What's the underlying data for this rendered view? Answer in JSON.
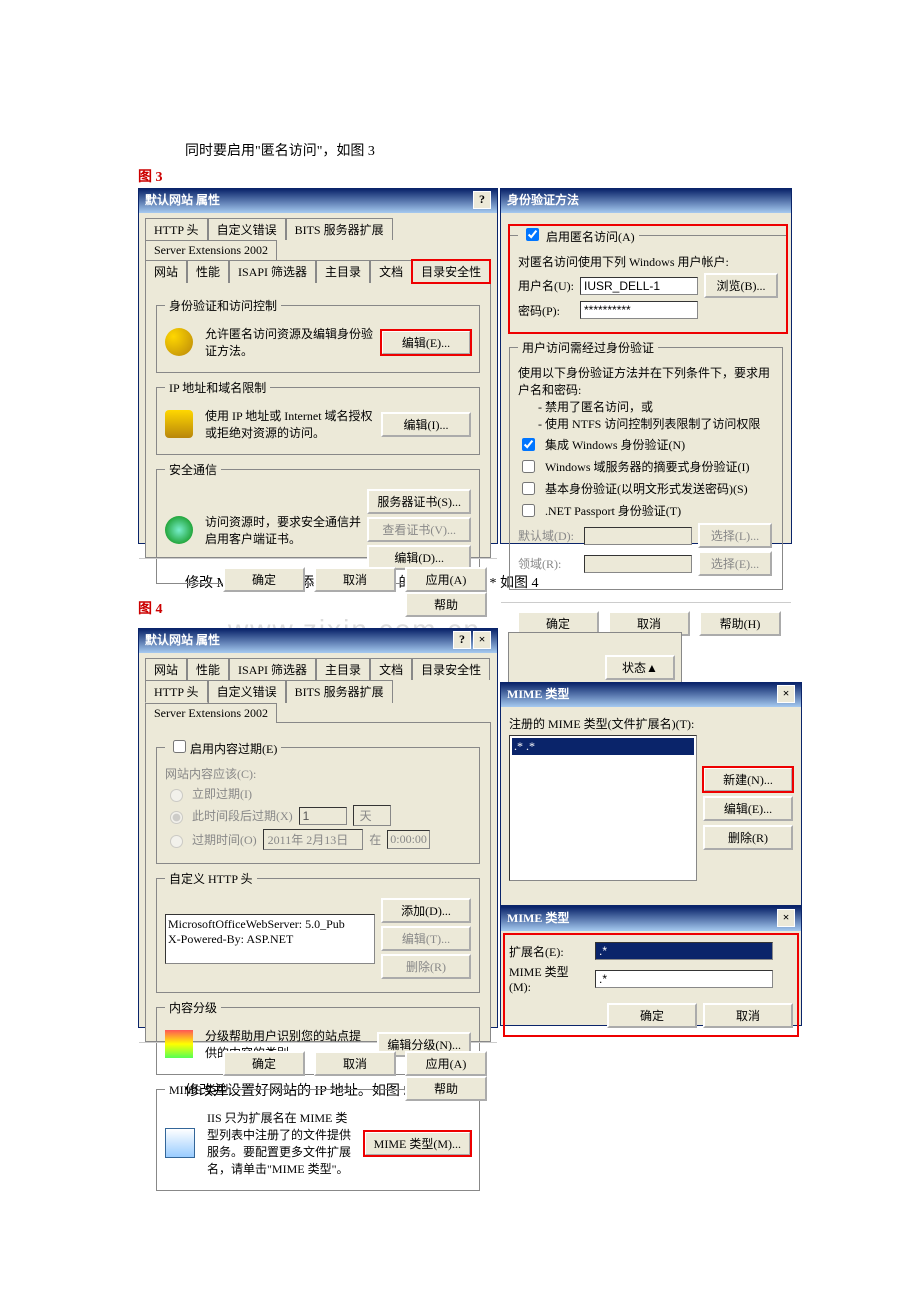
{
  "doc": {
    "text_fig3_intro": "同时要启用\"匿名访问\"，如图 3",
    "fig3_label": "图 3",
    "text_fig4_intro": "修改 MIME 类型，添加或者将. bin 的类型修改为. * 如图 4",
    "fig4_label": "图 4",
    "text_fig5_intro": "修改并设置好网站的 IP 地址。如图 5",
    "watermark": "www.zixin.com.cn"
  },
  "fig3": {
    "left": {
      "title": "默认网站 属性",
      "tabs_row1": [
        "HTTP 头",
        "自定义错误",
        "BITS 服务器扩展",
        "Server Extensions 2002"
      ],
      "tabs_row2": [
        "网站",
        "性能",
        "ISAPI 筛选器",
        "主目录",
        "文档",
        "目录安全性"
      ],
      "group_auth": {
        "legend": "身份验证和访问控制",
        "text": "允许匿名访问资源及编辑身份验证方法。",
        "btn_edit": "编辑(E)..."
      },
      "group_ip": {
        "legend": "IP 地址和域名限制",
        "text": "使用 IP 地址或 Internet 域名授权或拒绝对资源的访问。",
        "btn_edit": "编辑(I)..."
      },
      "group_sec": {
        "legend": "安全通信",
        "text": "访问资源时，要求安全通信并启用客户端证书。",
        "btn_cert": "服务器证书(S)...",
        "btn_view": "查看证书(V)...",
        "btn_edit": "编辑(D)..."
      },
      "btns": {
        "ok": "确定",
        "cancel": "取消",
        "apply": "应用(A)",
        "help": "帮助"
      }
    },
    "right": {
      "title": "身份验证方法",
      "anon": {
        "chk_label": "启用匿名访问(A)",
        "desc": "对匿名访问使用下列 Windows 用户帐户:",
        "user_label": "用户名(U):",
        "user_value": "IUSR_DELL-1",
        "btn_browse": "浏览(B)...",
        "pass_label": "密码(P):",
        "pass_value": "**********"
      },
      "authreq": {
        "legend": "用户访问需经过身份验证",
        "desc": "使用以下身份验证方法并在下列条件下，要求用户名和密码:",
        "l1": "- 禁用了匿名访问，或",
        "l2": "- 使用 NTFS 访问控制列表限制了访问权限",
        "c1": "集成 Windows 身份验证(N)",
        "c2": "Windows 域服务器的摘要式身份验证(I)",
        "c3": "基本身份验证(以明文形式发送密码)(S)",
        "c4": ".NET Passport 身份验证(T)",
        "domain_label": "默认域(D):",
        "realm_label": "领域(R):",
        "btn_sel1": "选择(L)...",
        "btn_sel2": "选择(E)..."
      },
      "btns": {
        "ok": "确定",
        "cancel": "取消",
        "help": "帮助(H)"
      }
    }
  },
  "fig4": {
    "left": {
      "title": "默认网站 属性",
      "tabs_row1": [
        "网站",
        "性能",
        "ISAPI 筛选器",
        "主目录",
        "文档",
        "目录安全性"
      ],
      "tabs_row2": [
        "HTTP 头",
        "自定义错误",
        "BITS 服务器扩展",
        "Server Extensions 2002"
      ],
      "expire": {
        "chk": "启用内容过期(E)",
        "desc": "网站内容应该(C):",
        "r1": "立即过期(I)",
        "r2": "此时间段后过期(X)",
        "r2_num": "1",
        "r2_unit": "天",
        "r3": "过期时间(O)",
        "r3_date": "2011年 2月13日",
        "r3_at": "在",
        "r3_time": "0:00:00"
      },
      "custom_http": {
        "legend": "自定义 HTTP 头",
        "item1": "MicrosoftOfficeWebServer: 5.0_Pub",
        "item2": "X-Powered-By: ASP.NET",
        "btn_add": "添加(D)...",
        "btn_edit": "编辑(T)...",
        "btn_del": "删除(R)"
      },
      "rating": {
        "legend": "内容分级",
        "text": "分级帮助用户识别您的站点提供的内容的类别。",
        "btn": "编辑分级(N)..."
      },
      "mime": {
        "legend": "MIME 类型",
        "text": "IIS 只为扩展名在 MIME 类型列表中注册了的文件提供服务。要配置更多文件扩展名，请单击\"MIME 类型\"。",
        "btn": "MIME 类型(M)..."
      },
      "btns": {
        "ok": "确定",
        "cancel": "取消",
        "apply": "应用(A)",
        "help": "帮助"
      }
    },
    "topright": {
      "btn_status": "状态▲"
    },
    "mimelist": {
      "title": "MIME 类型",
      "label": "注册的 MIME 类型(文件扩展名)(T):",
      "item": ".*    .*",
      "btn_new": "新建(N)...",
      "btn_edit": "编辑(E)...",
      "btn_del": "删除(R)"
    },
    "mimedit": {
      "title": "MIME 类型",
      "ext_label": "扩展名(E):",
      "ext_value": ".*",
      "type_label": "MIME 类型(M):",
      "type_value": ".*",
      "btn_ok": "确定",
      "btn_cancel": "取消"
    }
  }
}
